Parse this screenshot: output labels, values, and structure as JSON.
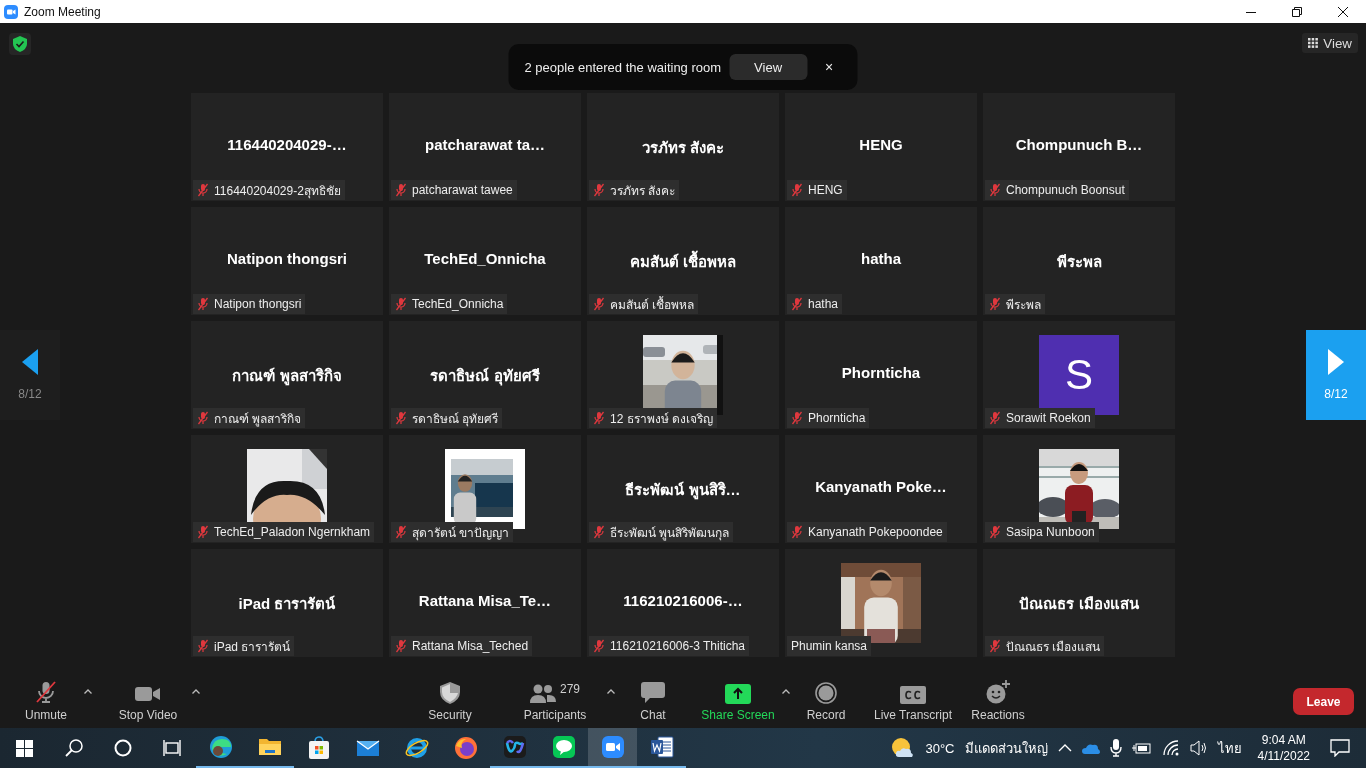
{
  "window": {
    "title": "Zoom Meeting"
  },
  "top_bar": {
    "view_button": "View"
  },
  "notification": {
    "message": "2 people entered the waiting room",
    "button": "View",
    "close": "×"
  },
  "nav": [
    {
      "kind": "previous",
      "page": "8/12",
      "highlighted": false
    },
    {
      "kind": "next",
      "page": "8/12",
      "highlighted": true
    }
  ],
  "tiles": [
    {
      "kind": "name",
      "title": "116440204029-…",
      "label": "116440204029-2สุทธิชัย",
      "muted": true
    },
    {
      "kind": "name",
      "title": "patcharawat  ta…",
      "label": "patcharawat tawee",
      "muted": true
    },
    {
      "kind": "name",
      "title": "วรภัทร สังคะ",
      "label": "วรภัทร สังคะ",
      "muted": true
    },
    {
      "kind": "name",
      "title": "HENG",
      "label": "HENG",
      "muted": true
    },
    {
      "kind": "name",
      "title": "Chompunuch  B…",
      "label": "Chompunuch Boonsut",
      "muted": true
    },
    {
      "kind": "name",
      "title": "Natipon thongsri",
      "label": "Natipon thongsri",
      "muted": true
    },
    {
      "kind": "name",
      "title": "TechEd_Onnicha",
      "label": "TechEd_Onnicha",
      "muted": true
    },
    {
      "kind": "name",
      "title": "คมสันต์ เชื้อพหล",
      "label": "คมสันต์ เชื้อพหล",
      "muted": true
    },
    {
      "kind": "name",
      "title": "hatha",
      "label": "hatha",
      "muted": true
    },
    {
      "kind": "name",
      "title": "พีระพล",
      "label": "พีระพล",
      "muted": true
    },
    {
      "kind": "name",
      "title": "กาณฑ์ พูลสาริกิจ",
      "label": "กาณฑ์ พูลสาริกิจ",
      "muted": true
    },
    {
      "kind": "name",
      "title": "รดาธิษณ์ อุทัยศรี",
      "label": "รดาธิษณ์ อุทัยศรี",
      "muted": true
    },
    {
      "kind": "video",
      "label": "12 ธราพงษ์ ดงเจริญ",
      "muted": true
    },
    {
      "kind": "name",
      "title": "Phornticha",
      "label": "Phornticha",
      "muted": true
    },
    {
      "kind": "avatar",
      "initial": "S",
      "color": "#4f2fb0",
      "label": "Sorawit Roekon",
      "muted": true
    },
    {
      "kind": "video",
      "label": "TechEd_Paladon Ngernkham",
      "muted": true
    },
    {
      "kind": "video",
      "label": "สุดารัตน์ ขาปัญญา",
      "muted": true
    },
    {
      "kind": "name",
      "title": "ธีระพัฒน์  พูนสิริ…",
      "label": "ธีระพัฒน์  พูนสิริพัฒนกุล",
      "muted": true
    },
    {
      "kind": "name",
      "title": "Kanyanath  Poke…",
      "label": "Kanyanath Pokepoondee",
      "muted": true
    },
    {
      "kind": "video",
      "label": "Sasipa Nunboon",
      "muted": true
    },
    {
      "kind": "name",
      "title": "iPad ธารารัตน์",
      "label": "iPad ธารารัตน์",
      "muted": true
    },
    {
      "kind": "name",
      "title": "Rattana  Misa_Te…",
      "label": "Rattana Misa_Teched",
      "muted": true
    },
    {
      "kind": "name",
      "title": "116210216006-…",
      "label": "116210216006-3 Thiticha",
      "muted": true
    },
    {
      "kind": "video",
      "label": "Phumin kansa",
      "muted": false
    },
    {
      "kind": "name",
      "title": "ปัณณธร เมืองแสน",
      "label": "ปัณณธร เมืองแสน",
      "muted": true
    }
  ],
  "toolbar": {
    "items": [
      {
        "kind": "mic",
        "label": "Unmute",
        "muted": true,
        "caret": true
      },
      {
        "kind": "video",
        "label": "Stop Video",
        "caret": true
      },
      {
        "kind": "security",
        "label": "Security",
        "caret": false
      },
      {
        "kind": "participants",
        "label": "Participants",
        "count": "279",
        "caret": true
      },
      {
        "kind": "chat",
        "label": "Chat",
        "caret": false
      },
      {
        "kind": "share",
        "label": "Share Screen",
        "caret": true
      },
      {
        "kind": "record",
        "label": "Record",
        "caret": false
      },
      {
        "kind": "cc",
        "label": "Live Transcript",
        "caret": false
      },
      {
        "kind": "reactions",
        "label": "Reactions",
        "caret": false
      }
    ],
    "leave": "Leave"
  },
  "taskbar": {
    "apps": [
      {
        "kind": "edge",
        "running": true,
        "selected": false
      },
      {
        "kind": "folder",
        "running": true,
        "selected": false
      },
      {
        "kind": "store",
        "running": false,
        "selected": false
      },
      {
        "kind": "mail",
        "running": false,
        "selected": false
      },
      {
        "kind": "ie",
        "running": false,
        "selected": false
      },
      {
        "kind": "firefox",
        "running": false,
        "selected": false
      },
      {
        "kind": "webex",
        "running": true,
        "selected": false
      },
      {
        "kind": "line",
        "running": true,
        "selected": false
      },
      {
        "kind": "zoom",
        "running": true,
        "selected": true
      },
      {
        "kind": "word",
        "running": true,
        "selected": false
      }
    ],
    "weather": {
      "temperature": "30°C",
      "condition": "มีแดดส่วนใหญ่"
    },
    "language": "ไทย",
    "time": "9:04 AM",
    "date": "4/11/2022"
  }
}
